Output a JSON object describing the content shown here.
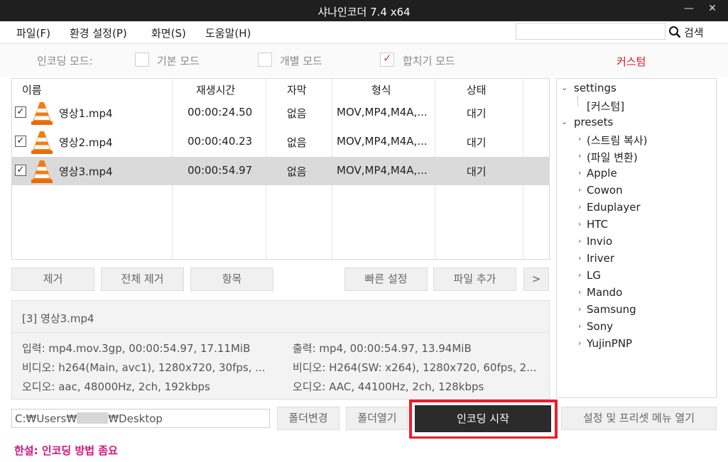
{
  "window": {
    "title": "샤나인코더  7.4 x64",
    "minimize": "—",
    "close": "✕"
  },
  "menu": {
    "file": "파일(F)",
    "settings": "환경 설정(P)",
    "view": "화면(S)",
    "help": "도움말(H)"
  },
  "search": {
    "value": "",
    "placeholder": "",
    "button_label": "검색"
  },
  "encoding_mode": {
    "label": "인코딩 모드:",
    "modes": [
      {
        "label": "기본 모드",
        "checked": false
      },
      {
        "label": "개별 모드",
        "checked": false
      },
      {
        "label": "합치기 모드",
        "checked": true
      }
    ],
    "custom_label": "커스텀"
  },
  "file_list": {
    "columns": [
      "이름",
      "재생시간",
      "자막",
      "형식",
      "상태"
    ],
    "rows": [
      {
        "checked": true,
        "name": "영상1.mp4",
        "duration": "00:00:24.50",
        "subtitle": "없음",
        "format": "MOV,MP4,M4A,...",
        "status": "대기",
        "selected": false
      },
      {
        "checked": true,
        "name": "영상2.mp4",
        "duration": "00:00:40.23",
        "subtitle": "없음",
        "format": "MOV,MP4,M4A,...",
        "status": "대기",
        "selected": false
      },
      {
        "checked": true,
        "name": "영상3.mp4",
        "duration": "00:00:54.97",
        "subtitle": "없음",
        "format": "MOV,MP4,M4A,...",
        "status": "대기",
        "selected": true
      }
    ]
  },
  "list_buttons": {
    "remove": "제거",
    "remove_all": "전체 제거",
    "item": "항목",
    "quick_settings": "빠른 설정",
    "add_file": "파일 추가",
    "more": ">"
  },
  "info": {
    "title": "[3] 영상3.mp4",
    "input": "입력: mp4.mov.3gp, 00:00:54.97, 17.11MiB",
    "input_video": "비디오: h264(Main, avc1), 1280x720, 30fps, ...",
    "input_audio": "오디오: aac, 48000Hz, 2ch, 192kbps",
    "output": "출력: mp4, 00:00:54.97, 13.94MiB",
    "output_video": "비디오: H264(SW: x264), 1280x720, 60fps, 2...",
    "output_audio": "오디오: AAC, 44100Hz, 2ch, 128kbps"
  },
  "tree": {
    "settings": "settings",
    "custom": "[커스텀]",
    "presets": "presets",
    "preset_items": [
      "(스트림 복사)",
      "(파일 변환)",
      "Apple",
      "Cowon",
      "Eduplayer",
      "HTC",
      "Invio",
      "Iriver",
      "LG",
      "Mando",
      "Samsung",
      "Sony",
      "YujinPNP"
    ]
  },
  "bottom": {
    "path_prefix": "C:₩Users₩",
    "path_suffix": "₩Desktop",
    "change_folder": "폴더변경",
    "open_folder": "폴더열기",
    "start_encoding": "인코딩 시작",
    "open_menu": "설정 및 프리셋 메뉴 열기"
  },
  "status": {
    "text": "한설: 인코딩 방법 좀요"
  },
  "colors": {
    "accent_red": "#ee1c2a",
    "custom_red": "#e0122b",
    "status_magenta": "#d3137d",
    "check_pink": "#c23d65",
    "start_button": "#2b2b2b"
  }
}
